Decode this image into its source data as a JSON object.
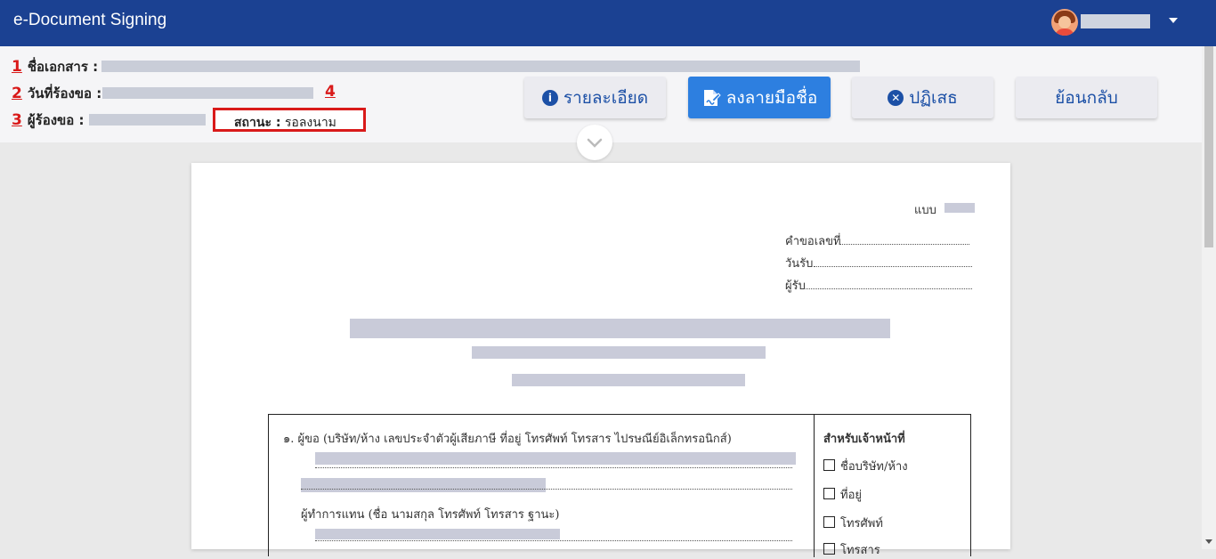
{
  "app": {
    "title": "e-Document Signing"
  },
  "user": {
    "name": ""
  },
  "info": {
    "doc_name_label": "ชื่อเอกสาร :",
    "request_date_label": "วันที่ร้องขอ :",
    "requester_label": "ผู้ร้องขอ :",
    "status_label": "สถานะ :",
    "status_value": "รอลงนาม",
    "markers": [
      "1",
      "2",
      "3",
      "4"
    ]
  },
  "actions": {
    "detail": "รายละเอียด",
    "sign": "ลงลายมือชื่อ",
    "reject": "ปฏิเสธ",
    "back": "ย้อนกลับ"
  },
  "document": {
    "form_label": "แบบ",
    "request_no": "คำขอเลขที่",
    "received_date": "วันรับ",
    "receiver": "ผู้รับ",
    "section1": "๑. ผู้ขอ (บริษัท/ห้าง เลขประจำตัวผู้เสียภาษี ที่อยู่ โทรศัพท์ โทรสาร ไปรษณีย์อิเล็กทรอนิกส์)",
    "agent": "ผู้ทำการแทน (ชื่อ นามสกุล โทรศัพท์ โทรสาร ฐานะ)",
    "officer_title": "สำหรับเจ้าหน้าที่",
    "officer_items": [
      "ชื่อบริษัท/ห้าง",
      "ที่อยู่",
      "โทรศัพท์",
      "โทรสาร"
    ]
  },
  "colors": {
    "topbar": "#1b4192",
    "primary": "#2d7fe0",
    "marker_red": "#d91a1a",
    "link_blue": "#1c50a6"
  }
}
